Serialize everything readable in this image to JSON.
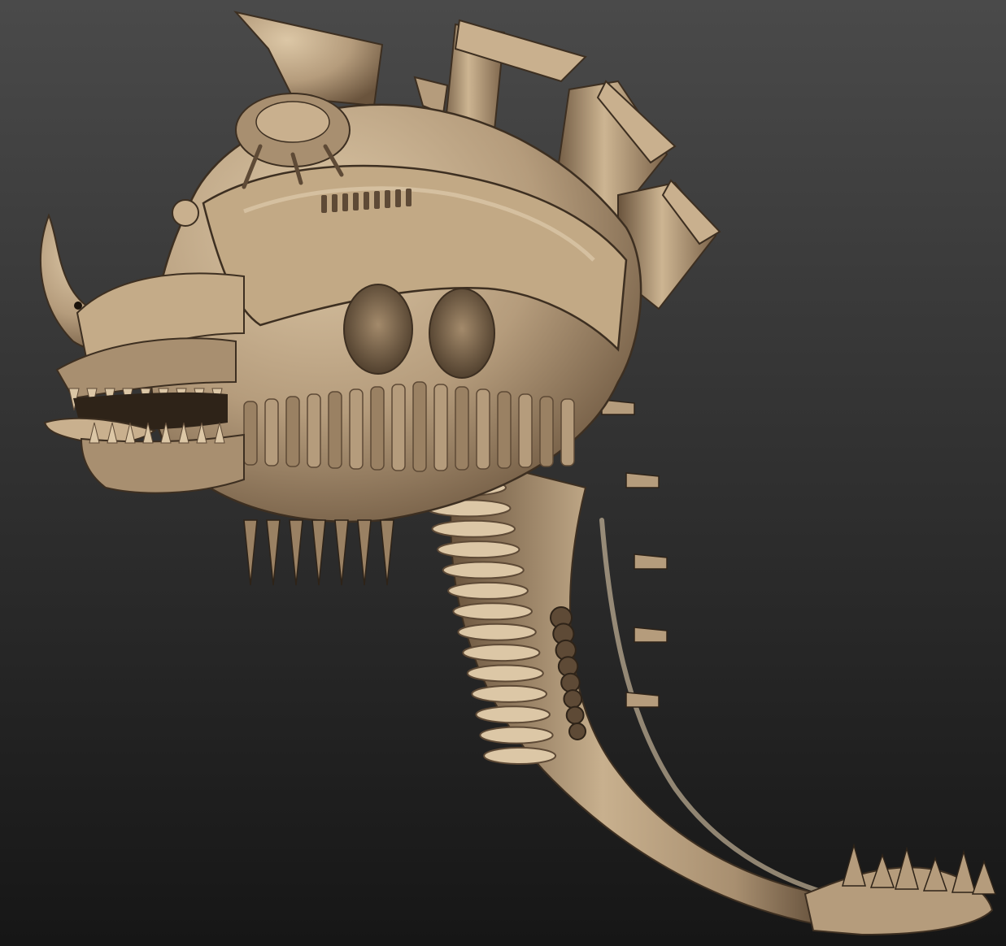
{
  "viewport": {
    "background_top": "#4a4a4a",
    "background_bottom": "#161616",
    "material": {
      "base": "#b59c7c",
      "highlight": "#dcc7a6",
      "mid": "#9a8163",
      "shadow": "#5e4a36",
      "deep": "#2e2318"
    },
    "subject": "sculpted-creature-head-icon"
  }
}
